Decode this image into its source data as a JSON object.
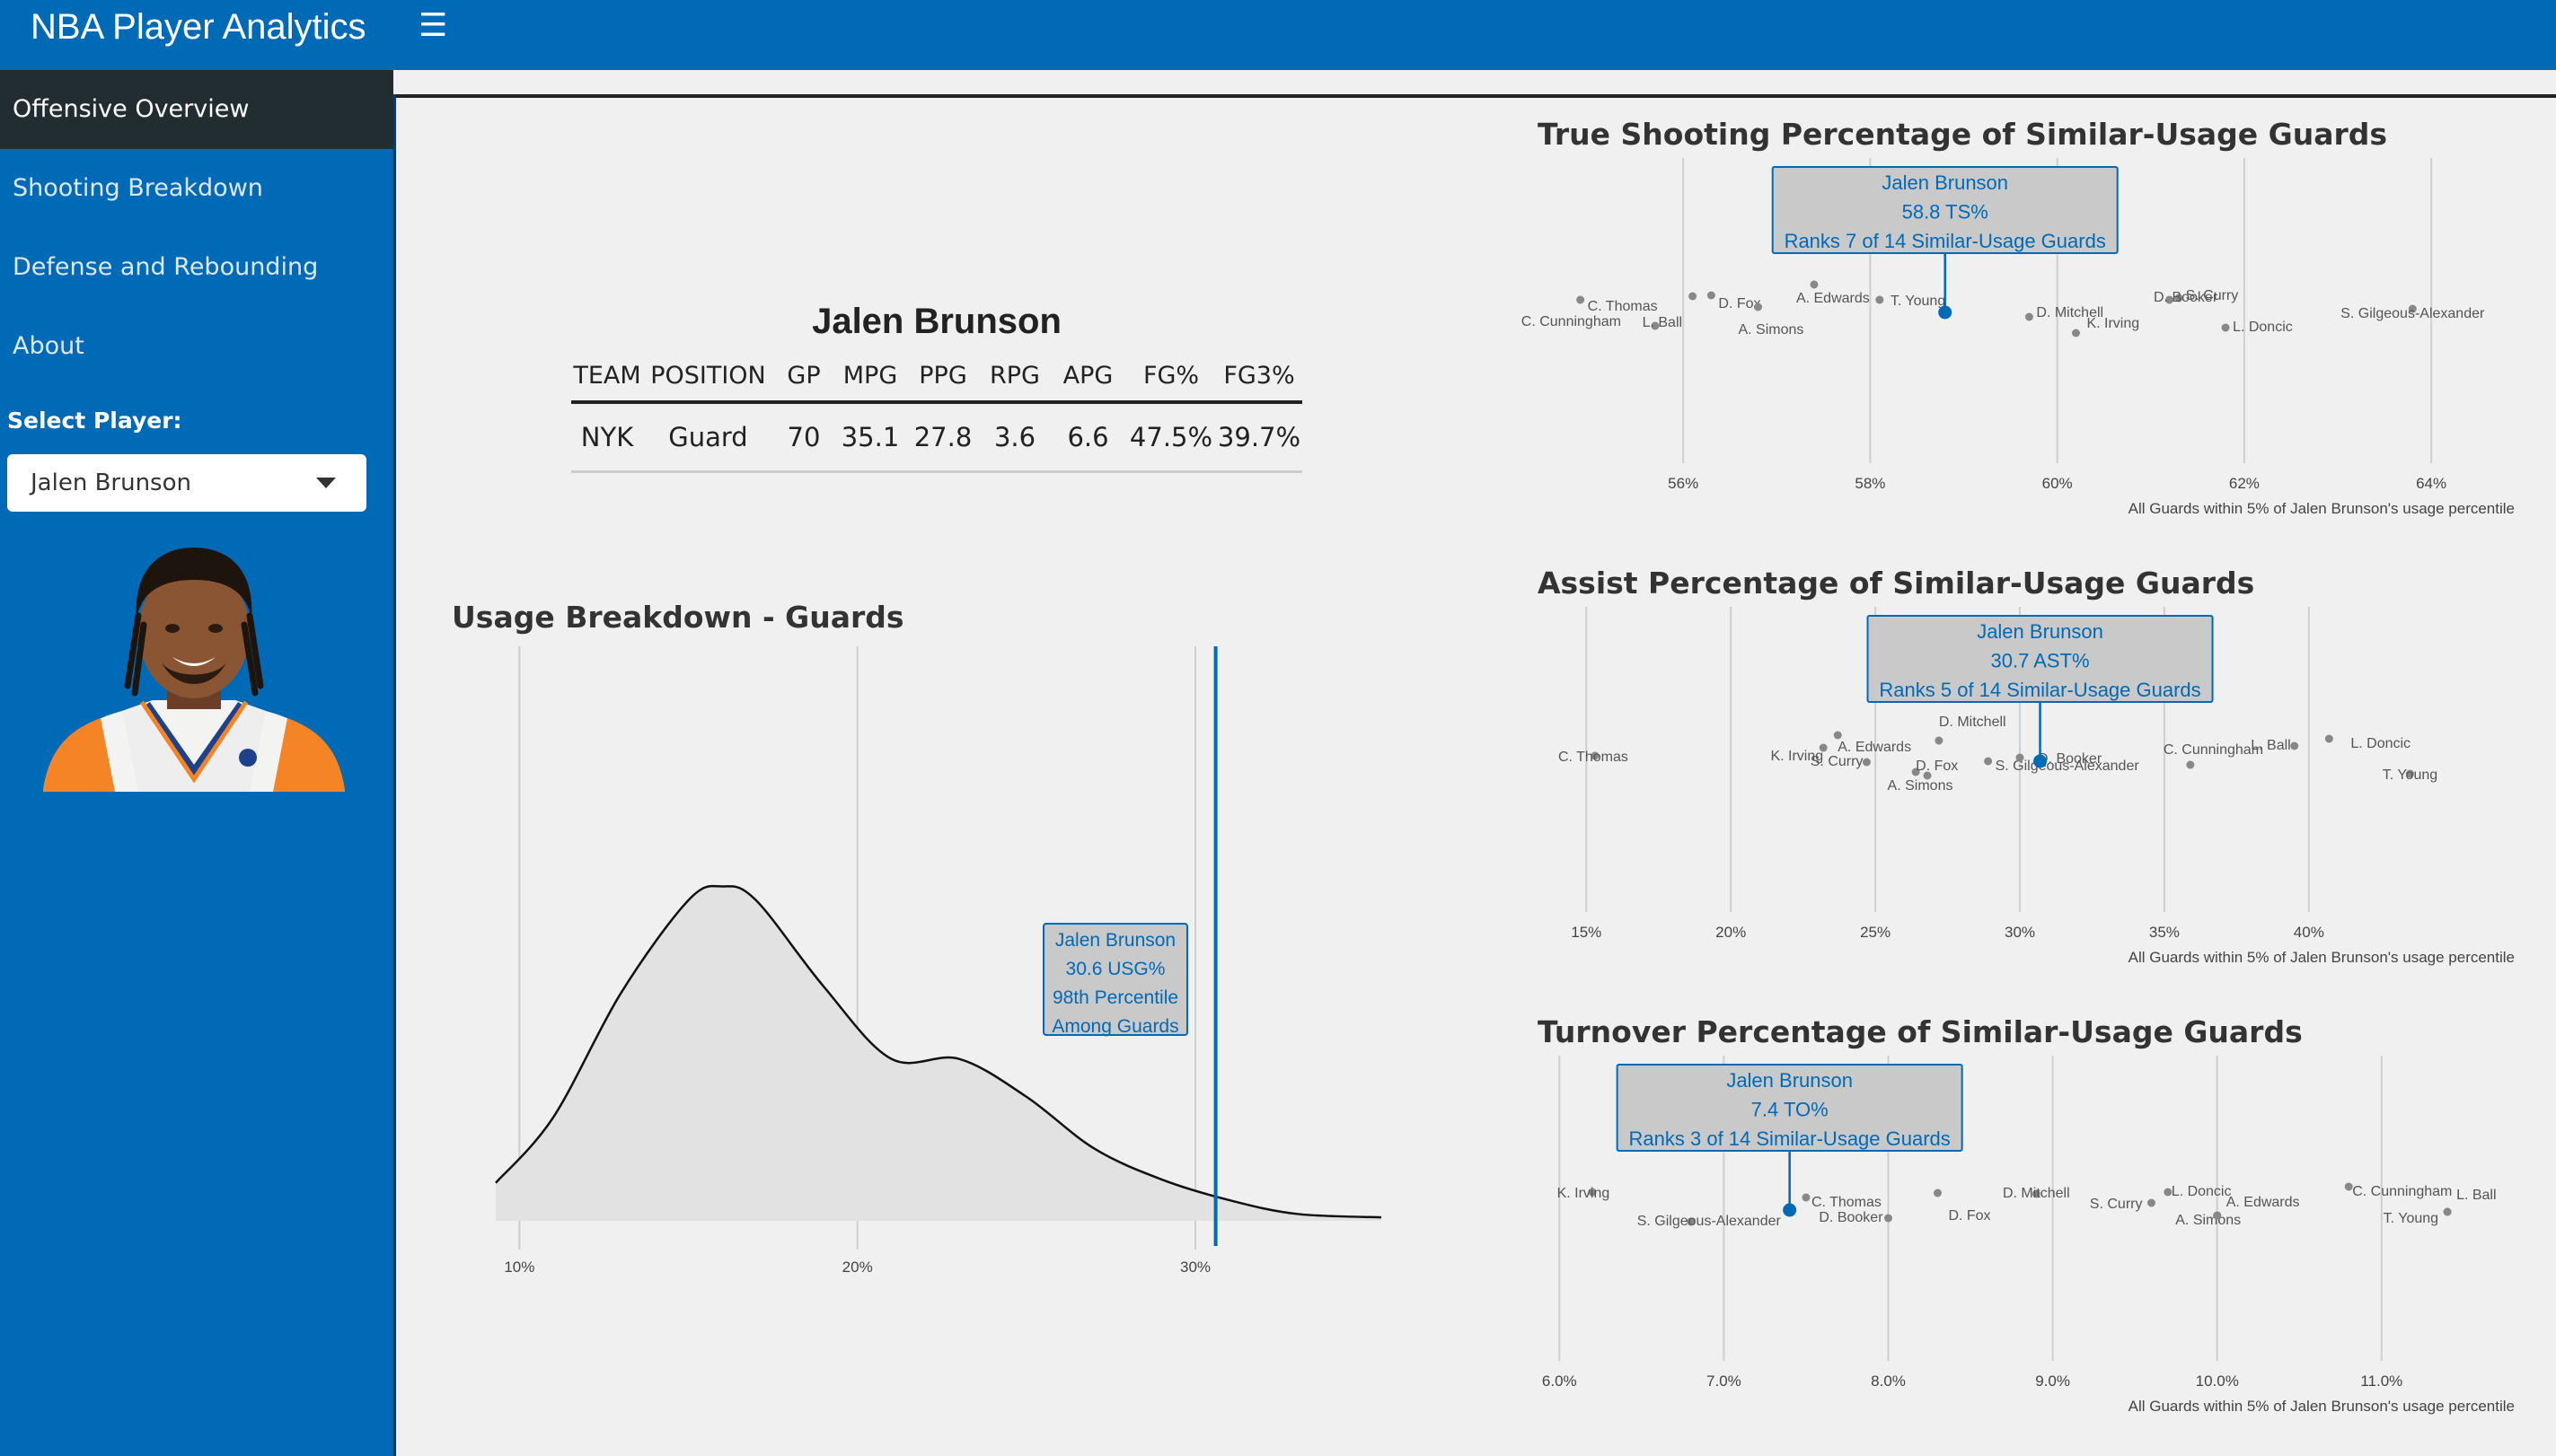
{
  "app": {
    "title": "NBA Player Analytics",
    "menu_icon": "hamburger-icon"
  },
  "sidebar": {
    "items": [
      {
        "label": "Offensive Overview",
        "active": true
      },
      {
        "label": "Shooting Breakdown"
      },
      {
        "label": "Defense and Rebounding"
      },
      {
        "label": "About"
      }
    ],
    "select_label": "Select Player:",
    "selected_player": "Jalen Brunson"
  },
  "player": {
    "name": "Jalen Brunson",
    "headers": [
      "TEAM",
      "POSITION",
      "GP",
      "MPG",
      "PPG",
      "RPG",
      "APG",
      "FG%",
      "FG3%"
    ],
    "values": [
      "NYK",
      "Guard",
      "70",
      "35.1",
      "27.8",
      "3.6",
      "6.6",
      "47.5%",
      "39.7%"
    ]
  },
  "colors": {
    "brand": "#006ab7",
    "highlight": "#006ab7",
    "nav_active": "#222d32"
  },
  "chart_data": [
    {
      "type": "area",
      "title": "Usage Breakdown - Guards",
      "x": [
        9.3,
        11,
        13,
        15,
        16,
        17,
        19,
        21,
        23,
        25,
        27,
        29,
        31,
        33,
        35.5
      ],
      "y": [
        0.11,
        0.3,
        0.66,
        0.93,
        0.97,
        0.93,
        0.68,
        0.47,
        0.47,
        0.36,
        0.21,
        0.12,
        0.06,
        0.02,
        0.01
      ],
      "xlim": [
        9.3,
        35.5
      ],
      "ticks": [
        "10%",
        "20%",
        "30%"
      ],
      "tick_values": [
        10,
        20,
        30
      ],
      "marker": {
        "x": 30.6,
        "label": [
          "Jalen Brunson",
          "30.6 USG%",
          "98th Percentile",
          "Among Guards"
        ]
      }
    },
    {
      "type": "scatter",
      "title": "True Shooting Percentage of Similar-Usage Guards",
      "xlim": [
        54.5,
        64.7
      ],
      "ticks": [
        "56%",
        "58%",
        "60%",
        "62%",
        "64%"
      ],
      "tick_values": [
        56,
        58,
        60,
        62,
        64
      ],
      "note": "All Guards within 5% of Jalen Brunson's usage percentile",
      "highlight": {
        "name": "Jalen Brunson",
        "x": 58.8,
        "label": [
          "Jalen Brunson",
          "58.8 TS%",
          "Ranks 7 of 14 Similar-Usage Guards"
        ]
      },
      "points": [
        {
          "name": "C. Thomas",
          "x": 54.9
        },
        {
          "name": "C. Cunningham",
          "x": 55.7
        },
        {
          "name": "L. Ball",
          "x": 56.1
        },
        {
          "name": "D. Fox",
          "x": 56.3
        },
        {
          "name": "A. Simons",
          "x": 56.8
        },
        {
          "name": "A. Edwards",
          "x": 57.4
        },
        {
          "name": "T. Young",
          "x": 58.1
        },
        {
          "name": "D. Mitchell",
          "x": 59.7
        },
        {
          "name": "K. Irving",
          "x": 60.2
        },
        {
          "name": "S. Curry",
          "x": 61.2
        },
        {
          "name": "D. Booker",
          "x": 61.3
        },
        {
          "name": "L. Doncic",
          "x": 61.8
        },
        {
          "name": "S. Gilgeous-Alexander",
          "x": 63.8
        }
      ]
    },
    {
      "type": "scatter",
      "title": "Assist Percentage of Similar-Usage Guards",
      "xlim": [
        13.5,
        46.5
      ],
      "ticks": [
        "15%",
        "20%",
        "25%",
        "30%",
        "35%",
        "40%"
      ],
      "tick_values": [
        15,
        20,
        25,
        30,
        35,
        40
      ],
      "note": "All Guards within 5% of Jalen Brunson's usage percentile",
      "highlight": {
        "name": "Jalen Brunson",
        "x": 30.7,
        "label": [
          "Jalen Brunson",
          "30.7 AST%",
          "Ranks 5 of 14 Similar-Usage Guards"
        ]
      },
      "points": [
        {
          "name": "C. Thomas",
          "x": 15.3
        },
        {
          "name": "K. Irving",
          "x": 23.2
        },
        {
          "name": "A. Edwards",
          "x": 23.7
        },
        {
          "name": "S. Curry",
          "x": 24.7
        },
        {
          "name": "D. Fox",
          "x": 26.4
        },
        {
          "name": "A. Simons",
          "x": 26.8
        },
        {
          "name": "D. Mitchell",
          "x": 27.2
        },
        {
          "name": "S. Gilgeous-Alexander",
          "x": 28.9
        },
        {
          "name": "D. Booker",
          "x": 30.0
        },
        {
          "name": "C. Cunningham",
          "x": 35.9
        },
        {
          "name": "L. Ball",
          "x": 39.5
        },
        {
          "name": "L. Doncic",
          "x": 40.7
        },
        {
          "name": "T. Young",
          "x": 43.5
        }
      ]
    },
    {
      "type": "scatter",
      "title": "Turnover Percentage of Similar-Usage Guards",
      "xlim": [
        5.9,
        11.7
      ],
      "ticks": [
        "6.0%",
        "7.0%",
        "8.0%",
        "9.0%",
        "10.0%",
        "11.0%"
      ],
      "tick_values": [
        6.0,
        7.0,
        8.0,
        9.0,
        10.0,
        11.0
      ],
      "note": "All Guards within 5% of Jalen Brunson's usage percentile",
      "highlight": {
        "name": "Jalen Brunson",
        "x": 7.4,
        "label": [
          "Jalen Brunson",
          "7.4 TO%",
          "Ranks 3 of 14 Similar-Usage Guards"
        ]
      },
      "points": [
        {
          "name": "K. Irving",
          "x": 6.2
        },
        {
          "name": "S. Gilgeous-Alexander",
          "x": 6.8
        },
        {
          "name": "C. Thomas",
          "x": 7.5
        },
        {
          "name": "D. Booker",
          "x": 8.0
        },
        {
          "name": "D. Fox",
          "x": 8.3
        },
        {
          "name": "D. Mitchell",
          "x": 8.9
        },
        {
          "name": "S. Curry",
          "x": 9.6
        },
        {
          "name": "L. Doncic",
          "x": 9.7
        },
        {
          "name": "A. Simons",
          "x": 10.0
        },
        {
          "name": "A. Edwards",
          "x": 10.0
        },
        {
          "name": "C. Cunningham",
          "x": 10.8
        },
        {
          "name": "T. Young",
          "x": 11.4
        },
        {
          "name": "L. Ball",
          "x": 11.4
        }
      ]
    }
  ]
}
